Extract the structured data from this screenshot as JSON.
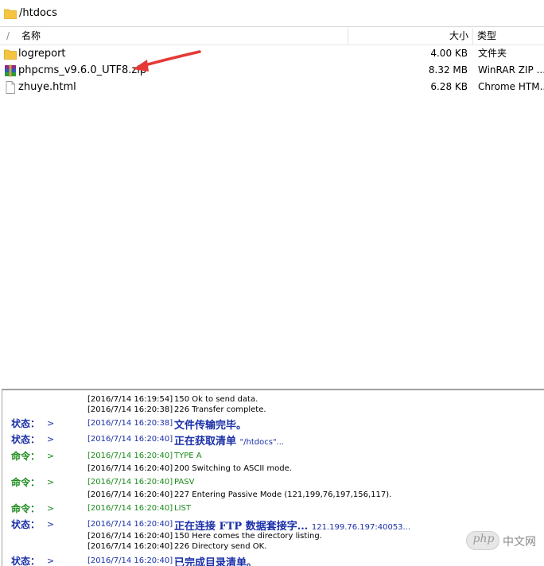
{
  "path_bar": {
    "path": "/htdocs"
  },
  "columns": {
    "up": "/",
    "name": "名称",
    "size": "大小",
    "type": "类型"
  },
  "files": [
    {
      "name": "logreport",
      "size": "4.00 KB",
      "type": "文件夹",
      "icon": "folder-icon"
    },
    {
      "name": "phpcms_v9.6.0_UTF8.zip",
      "size": "8.32 MB",
      "type": "WinRAR ZIP ...",
      "icon": "winrar-zip-icon"
    },
    {
      "name": "zhuye.html",
      "size": "6.28 KB",
      "type": "Chrome HTM...",
      "icon": "html-file-icon"
    }
  ],
  "log": [
    {
      "label": "",
      "arrow": "",
      "time": "[2016/7/14 16:19:54]",
      "message": "150 Ok to send data.",
      "kind": "response"
    },
    {
      "label": "",
      "arrow": "",
      "time": "[2016/7/14 16:20:38]",
      "message": "226 Transfer complete.",
      "kind": "response"
    },
    {
      "label": "状态：",
      "arrow": ">",
      "time": "[2016/7/14 16:20:38]",
      "message": "文件传输完毕。",
      "kind": "status"
    },
    {
      "label": "状态：",
      "arrow": ">",
      "time": "[2016/7/14 16:20:40]",
      "message": "正在获取清单",
      "message_tail": "\"/htdocs\"...",
      "kind": "status"
    },
    {
      "label": "命令：",
      "arrow": ">",
      "time": "[2016/7/14 16:20:40]",
      "message": "TYPE A",
      "kind": "command"
    },
    {
      "label": "",
      "arrow": "",
      "time": "[2016/7/14 16:20:40]",
      "message": "200 Switching to ASCII mode.",
      "kind": "response"
    },
    {
      "label": "命令：",
      "arrow": ">",
      "time": "[2016/7/14 16:20:40]",
      "message": "PASV",
      "kind": "command"
    },
    {
      "label": "",
      "arrow": "",
      "time": "[2016/7/14 16:20:40]",
      "message": "227 Entering Passive Mode (121,199,76,197,156,117).",
      "kind": "response"
    },
    {
      "label": "命令：",
      "arrow": ">",
      "time": "[2016/7/14 16:20:40]",
      "message": "LIST",
      "kind": "command"
    },
    {
      "label": "状态：",
      "arrow": ">",
      "time": "[2016/7/14 16:20:40]",
      "message": "正在连接 FTP 数据套接字...",
      "message_tail": "121.199.76.197:40053...",
      "kind": "status"
    },
    {
      "label": "",
      "arrow": "",
      "time": "[2016/7/14 16:20:40]",
      "message": "150 Here comes the directory listing.",
      "kind": "response"
    },
    {
      "label": "",
      "arrow": "",
      "time": "[2016/7/14 16:20:40]",
      "message": "226 Directory send OK.",
      "kind": "response"
    },
    {
      "label": "状态：",
      "arrow": ">",
      "time": "[2016/7/14 16:20:40]",
      "message": "已完成目录清单。",
      "kind": "status"
    }
  ],
  "watermark": {
    "badge": "php",
    "text": "中文网"
  },
  "colors": {
    "status": "#1a2fa8",
    "command": "#1a8a1a",
    "arrow": "#e53935",
    "folder": "#f5c542"
  }
}
